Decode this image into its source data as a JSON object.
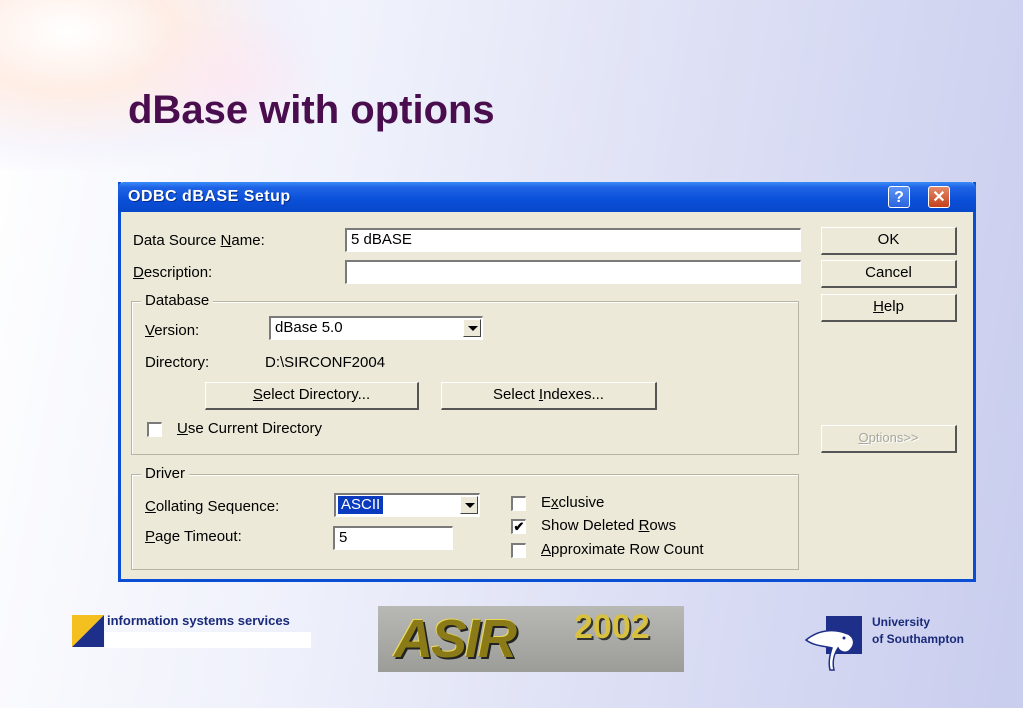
{
  "slide": {
    "title": "dBase with options"
  },
  "window": {
    "title": "ODBC dBASE Setup",
    "help_glyph": "?",
    "close_glyph": "✕"
  },
  "fields": {
    "dsn_label_pre": "Data Source ",
    "dsn_label_key": "N",
    "dsn_label_post": "ame:",
    "dsn_value": "5 dBASE",
    "desc_label_key": "D",
    "desc_label_post": "escription:",
    "desc_value": ""
  },
  "database": {
    "legend": "Database",
    "version_label_key": "V",
    "version_label_post": "ersion:",
    "version_value": "dBase 5.0",
    "directory_label": "Directory:",
    "directory_value": "D:\\SIRCONF2004",
    "select_dir_key": "S",
    "select_dir_post": "elect Directory...",
    "select_idx_pre": "Select ",
    "select_idx_key": "I",
    "select_idx_post": "ndexes...",
    "use_current_key": "U",
    "use_current_post": "se Current Directory",
    "use_current_checked": false
  },
  "driver": {
    "legend": "Driver",
    "collating_label_key": "C",
    "collating_label_post": "ollating Sequence:",
    "collating_value": "ASCII",
    "timeout_label_key": "P",
    "timeout_label_post": "age Timeout:",
    "timeout_value": "5",
    "exclusive_pre": "E",
    "exclusive_key": "x",
    "exclusive_post": "clusive",
    "exclusive_checked": false,
    "show_deleted_pre": "Show Deleted ",
    "show_deleted_key": "R",
    "show_deleted_post": "ows",
    "show_deleted_checked": true,
    "approx_key": "A",
    "approx_post": "pproximate Row Count",
    "approx_checked": false
  },
  "buttons": {
    "ok": "OK",
    "cancel": "Cancel",
    "help_key": "H",
    "help_post": "elp",
    "options_key": "O",
    "options_post": "ptions>>"
  },
  "footer": {
    "iss_text": "information systems services",
    "asir_text": "ASIR",
    "asir_year": "2002",
    "uni_line1": "University",
    "uni_line2": "of Southampton"
  },
  "colors": {
    "title": "#4a0e4e",
    "titlebar": "#0a4fd8",
    "dialog_bg": "#ece9d8",
    "selection": "#0a3bbf"
  }
}
